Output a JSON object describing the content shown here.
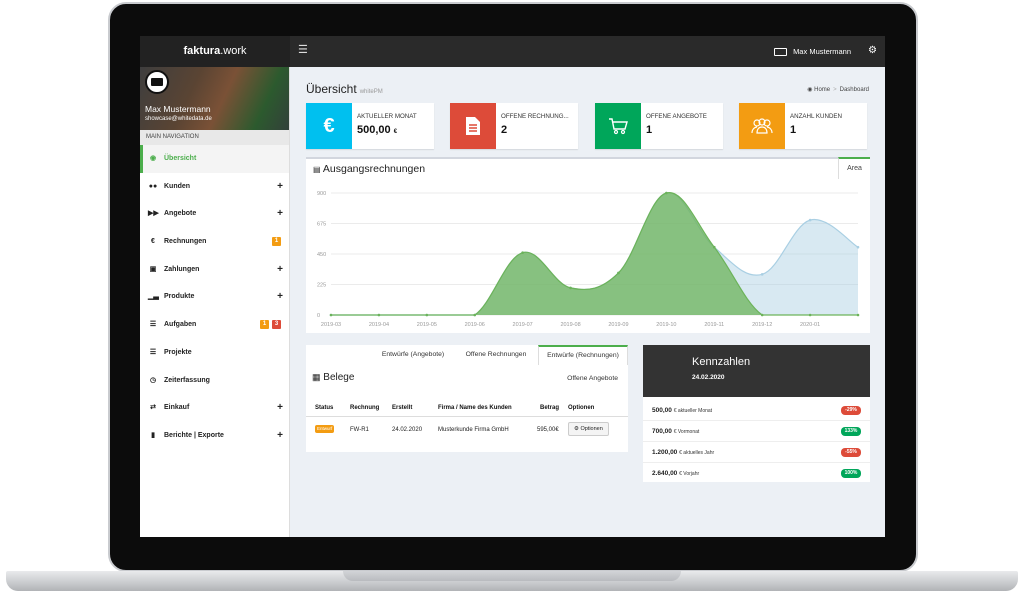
{
  "app": {
    "brand_bold": "faktura",
    "brand_rest": ".work",
    "menu_icon": "hamburger-icon",
    "user_name": "Max Mustermann"
  },
  "sidebar": {
    "user_name": "Max Mustermann",
    "user_email": "showcase@whitedata.de",
    "nav_header": "MAIN NAVIGATION",
    "items": [
      {
        "label": "Übersicht",
        "icon": "dashboard-icon",
        "active": true
      },
      {
        "label": "Kunden",
        "icon": "users-icon",
        "plus": true
      },
      {
        "label": "Angebote",
        "icon": "forward-icon",
        "plus": true
      },
      {
        "label": "Rechnungen",
        "icon": "euro-icon",
        "badges": [
          "1"
        ]
      },
      {
        "label": "Zahlungen",
        "icon": "money-icon",
        "plus": true
      },
      {
        "label": "Produkte",
        "icon": "chart-icon",
        "plus": true
      },
      {
        "label": "Aufgaben",
        "icon": "list-icon",
        "badges": [
          "1",
          "3"
        ]
      },
      {
        "label": "Projekte",
        "icon": "list-icon"
      },
      {
        "label": "Zeiterfassung",
        "icon": "clock-icon"
      },
      {
        "label": "Einkauf",
        "icon": "exchange-icon",
        "plus": true
      },
      {
        "label": "Berichte | Exporte",
        "icon": "book-icon",
        "plus": true
      }
    ]
  },
  "page": {
    "title": "Übersicht",
    "subtitle": "whitePM",
    "breadcrumb_home": "Home",
    "breadcrumb_current": "Dashboard"
  },
  "info_boxes": [
    {
      "label": "AKTUELLER MONAT",
      "value": "500,00",
      "unit": "€",
      "icon": "euro-icon",
      "color": "#00c0ef"
    },
    {
      "label": "OFFENE RECHNUNG...",
      "value": "2",
      "unit": "",
      "icon": "document-icon",
      "color": "#dd4b39"
    },
    {
      "label": "OFFENE ANGEBOTE",
      "value": "1",
      "unit": "",
      "icon": "cart-icon",
      "color": "#00a65a"
    },
    {
      "label": "ANZAHL KUNDEN",
      "value": "1",
      "unit": "",
      "icon": "users-icon",
      "color": "#f39c12"
    }
  ],
  "chart_panel": {
    "title": "Ausgangsrechnungen",
    "tab": "Area"
  },
  "chart_data": {
    "type": "area",
    "categories": [
      "2019-03",
      "2019-04",
      "2019-05",
      "2019-06",
      "2019-07",
      "2019-08",
      "2019-09",
      "2019-10",
      "2019-11",
      "2019-12",
      "2020-01",
      "2020-02"
    ],
    "ylim": [
      0,
      900
    ],
    "yticks": [
      "0",
      "225",
      "450",
      "675",
      "900"
    ],
    "series": [
      {
        "values": [
          0,
          0,
          0,
          0,
          460,
          200,
          310,
          900,
          500,
          300,
          700,
          500
        ],
        "color": "#a9cfe3"
      },
      {
        "values": [
          0,
          0,
          0,
          0,
          460,
          200,
          310,
          900,
          500,
          0,
          0,
          0
        ],
        "color": "#6cb35a"
      }
    ]
  },
  "belege": {
    "tabs": [
      "Entwürfe (Angebote)",
      "Offene Rechnungen",
      "Entwürfe (Rechnungen)"
    ],
    "title": "Belege",
    "right_label": "Offene Angebote",
    "columns": [
      "Status",
      "Rechnung",
      "Erstellt",
      "Firma / Name des Kunden",
      "Betrag",
      "Optionen"
    ],
    "rows": [
      {
        "status": "Entwurf",
        "rechnung": "FW-R1",
        "erstellt": "24.02.2020",
        "firma": "Musterkunde Firma GmbH",
        "betrag": "595,00€",
        "option": "Optionen"
      }
    ]
  },
  "kennzahlen": {
    "title": "Kennzahlen",
    "date": "24.02.2020",
    "rows": [
      {
        "value": "500,00",
        "desc": "€ aktueller Monat",
        "badge": "-29%",
        "color": "#dd4b39"
      },
      {
        "value": "700,00",
        "desc": "€ Vormonat",
        "badge": "133%",
        "color": "#00a65a"
      },
      {
        "value": "1.200,00",
        "desc": "€ aktuelles Jahr",
        "badge": "-55%",
        "color": "#dd4b39"
      },
      {
        "value": "2.640,00",
        "desc": "€ Vorjahr",
        "badge": "100%",
        "color": "#00a65a"
      }
    ]
  }
}
